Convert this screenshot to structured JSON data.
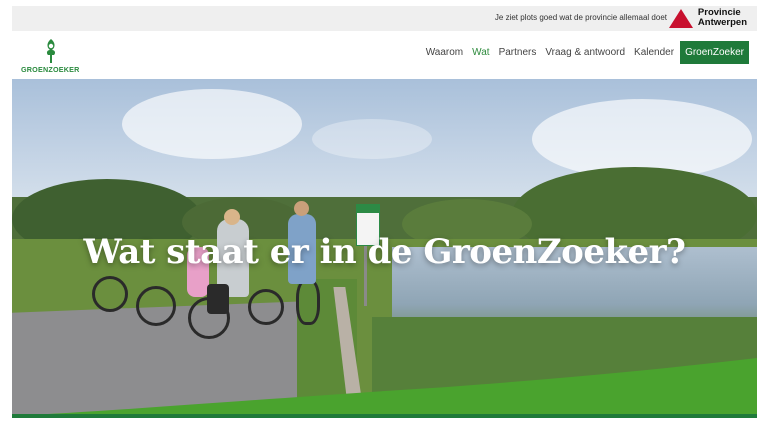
{
  "topbar": {
    "notice": "Je ziet plots goed wat de provincie allemaal doet",
    "province_line1": "Provincie",
    "province_line2": "Antwerpen"
  },
  "logo": {
    "text": "GROENZOEKER"
  },
  "nav": {
    "items": [
      {
        "label": "Waarom",
        "active": false
      },
      {
        "label": "Wat",
        "active": true
      },
      {
        "label": "Partners",
        "active": false
      },
      {
        "label": "Vraag & antwoord",
        "active": false
      },
      {
        "label": "Kalender",
        "active": false
      }
    ],
    "cta": "GroenZoeker"
  },
  "hero": {
    "title": "Wat staat er in de GroenZoeker?"
  },
  "colors": {
    "brand_green": "#1f7a3a",
    "active_link": "#2e8b3d",
    "province_red": "#c8102e",
    "wave_green": "#4aa32e"
  }
}
